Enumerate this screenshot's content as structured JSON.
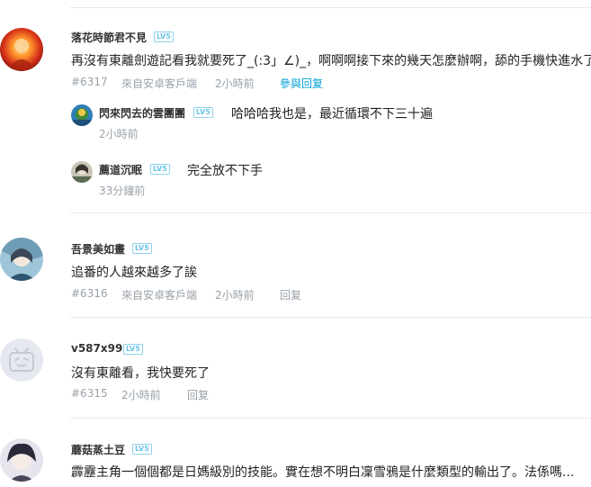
{
  "comments": [
    {
      "username": "落花時節君不見",
      "level": "LV5",
      "text": "再沒有東離劍遊記看我就要死了_(:3」∠)_，啊啊啊接下來的幾天怎麼辦啊，舔的手機快進水了",
      "floor": "#6317",
      "source": "來自安卓客戶端",
      "time": "2小時前",
      "reply_label": "參與回复",
      "replies": [
        {
          "username": "閃來閃去的雲團團",
          "level": "LV5",
          "text": "哈哈哈我也是，最近循環不下三十遍",
          "time": "2小時前"
        },
        {
          "username": "薦道沉眠",
          "level": "LV5",
          "text": "完全放不下手",
          "time": "33分鐘前"
        }
      ]
    },
    {
      "username": "吾景美如畫",
      "level": "LV5",
      "text": "追番的人越來越多了誒",
      "floor": "#6316",
      "source": "來自安卓客戶端",
      "time": "2小時前",
      "reply_label": "回复"
    },
    {
      "username": "v587x99",
      "level": "LV5",
      "text": "沒有東離看，我快要死了",
      "floor": "#6315",
      "time": "2小時前",
      "reply_label": "回复"
    },
    {
      "username": "蘑菇蒸土豆",
      "level": "LV5",
      "text": "霹靂主角一個個都是日媽級別的技能。實在想不明白凜雪鴉是什麼類型的輸出了。法係嗎..."
    }
  ],
  "colors": {
    "link": "#00a1d6",
    "meta": "#99a2aa",
    "level": "#6cc3e8",
    "divider": "#e5e9ef"
  }
}
